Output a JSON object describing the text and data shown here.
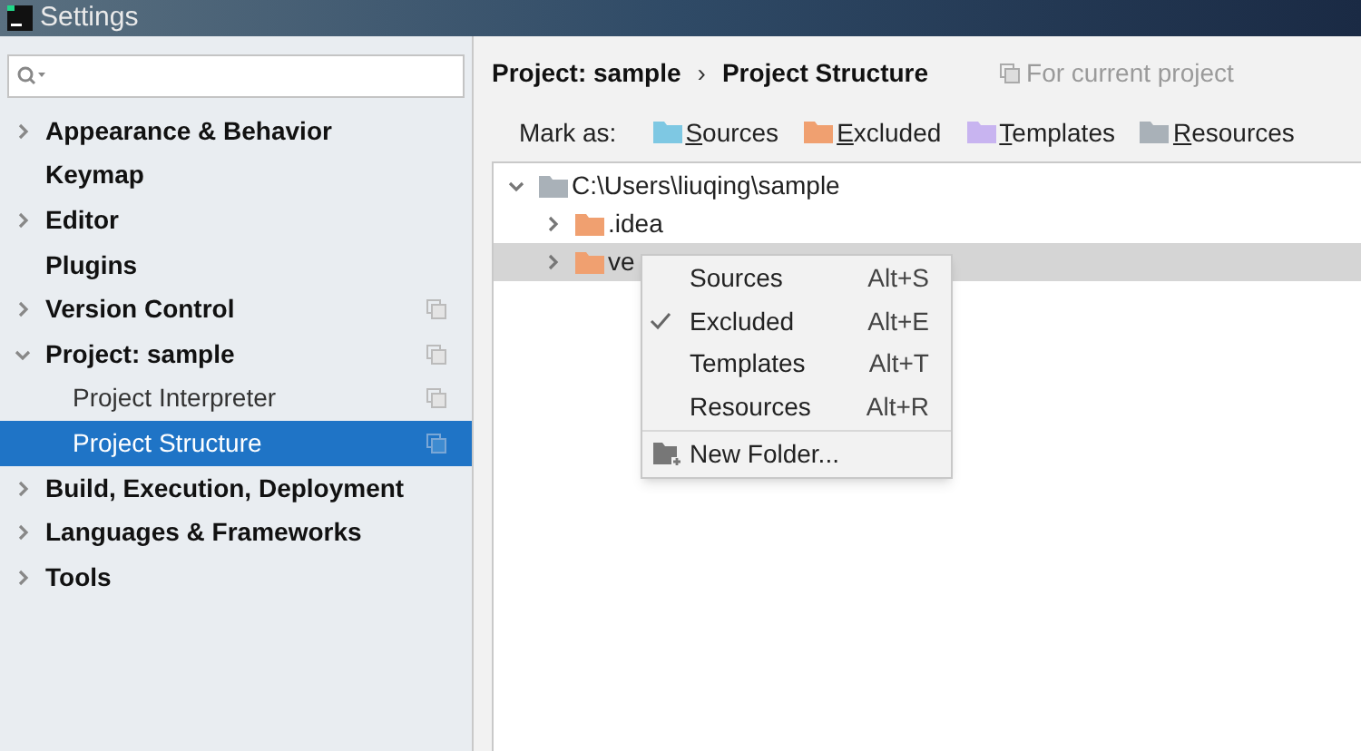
{
  "window": {
    "title": "Settings"
  },
  "sidebar": {
    "items": [
      {
        "label": "Appearance & Behavior",
        "expanded": false,
        "selected": false,
        "copy_icon": false
      },
      {
        "label": "Keymap",
        "selected": false,
        "copy_icon": false
      },
      {
        "label": "Editor",
        "expanded": false,
        "selected": false,
        "copy_icon": false
      },
      {
        "label": "Plugins",
        "selected": false,
        "copy_icon": false
      },
      {
        "label": "Version Control",
        "expanded": false,
        "selected": false,
        "copy_icon": true
      },
      {
        "label": "Project: sample",
        "expanded": true,
        "selected": false,
        "copy_icon": true,
        "children": [
          {
            "label": "Project Interpreter",
            "selected": false,
            "copy_icon": true
          },
          {
            "label": "Project Structure",
            "selected": true,
            "copy_icon": true
          }
        ]
      },
      {
        "label": "Build, Execution, Deployment",
        "expanded": false,
        "selected": false,
        "copy_icon": false
      },
      {
        "label": "Languages & Frameworks",
        "expanded": false,
        "selected": false,
        "copy_icon": false
      },
      {
        "label": "Tools",
        "expanded": false,
        "selected": false,
        "copy_icon": false
      }
    ]
  },
  "breadcrumb": {
    "parent": "Project: sample",
    "separator": "›",
    "current": "Project Structure",
    "scope": "For current project"
  },
  "mark_as": {
    "label": "Mark as:",
    "options": [
      {
        "label": "Sources",
        "color": "#7ec8e3"
      },
      {
        "label": "Excluded",
        "color": "#f0a070"
      },
      {
        "label": "Templates",
        "color": "#c8b4f0"
      },
      {
        "label": "Resources",
        "color": "#a9b1b8"
      }
    ]
  },
  "tree": [
    {
      "label": "C:\\Users\\liuqing\\sample",
      "expanded": true,
      "selected": false,
      "color": "#a9b1b8",
      "children": [
        {
          "label": ".idea",
          "expanded": false,
          "selected": false,
          "color": "#f0a070"
        },
        {
          "label": "ve",
          "expanded": false,
          "selected": true,
          "color": "#f0a070"
        }
      ]
    }
  ],
  "context_menu": {
    "items": [
      {
        "kind": "option",
        "label": "Sources",
        "shortcut": "Alt+S",
        "checked": false
      },
      {
        "kind": "option",
        "label": "Excluded",
        "shortcut": "Alt+E",
        "checked": true
      },
      {
        "kind": "option",
        "label": "Templates",
        "shortcut": "Alt+T",
        "checked": false
      },
      {
        "kind": "option",
        "label": "Resources",
        "shortcut": "Alt+R",
        "checked": false
      },
      {
        "kind": "action",
        "label": "New Folder..."
      }
    ]
  }
}
